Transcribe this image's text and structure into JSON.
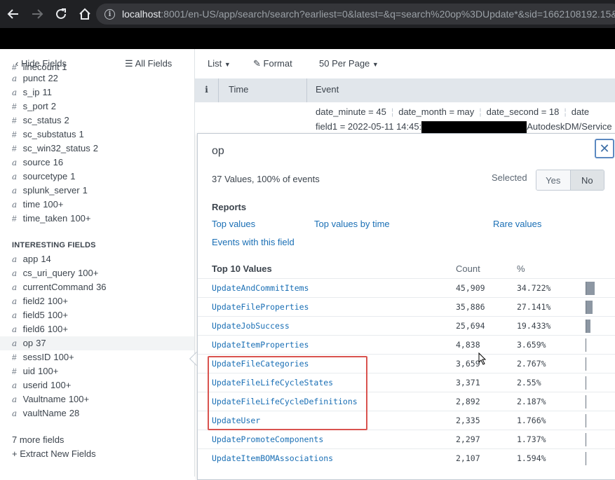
{
  "browser": {
    "url_host": "localhost",
    "url_rest": ":8001/en-US/app/search/search?earliest=0&latest=&q=search%20op%3DUpdate*&sid=1662108192.15&"
  },
  "sidebar": {
    "hide_fields": "Hide Fields",
    "all_fields": "All Fields",
    "top_partial": "linecount  1",
    "selected_fields": [
      {
        "type": "a",
        "name": "punct",
        "count": "22",
        "hash": true
      },
      {
        "type": "a",
        "name": "s_ip",
        "count": "11",
        "hash": false
      },
      {
        "type": "#",
        "name": "s_port",
        "count": "2",
        "hash": true
      },
      {
        "type": "#",
        "name": "sc_status",
        "count": "2",
        "hash": true
      },
      {
        "type": "#",
        "name": "sc_substatus",
        "count": "1",
        "hash": true
      },
      {
        "type": "#",
        "name": "sc_win32_status",
        "count": "2",
        "hash": true
      },
      {
        "type": "a",
        "name": "source",
        "count": "16",
        "hash": false
      },
      {
        "type": "a",
        "name": "sourcetype",
        "count": "1",
        "hash": false
      },
      {
        "type": "a",
        "name": "splunk_server",
        "count": "1",
        "hash": false
      },
      {
        "type": "a",
        "name": "time",
        "count": "100+",
        "hash": false
      },
      {
        "type": "#",
        "name": "time_taken",
        "count": "100+",
        "hash": true
      }
    ],
    "interesting_title": "INTERESTING FIELDS",
    "interesting_fields": [
      {
        "type": "a",
        "name": "app",
        "count": "14"
      },
      {
        "type": "a",
        "name": "cs_uri_query",
        "count": "100+"
      },
      {
        "type": "a",
        "name": "currentCommand",
        "count": "36"
      },
      {
        "type": "a",
        "name": "field2",
        "count": "100+"
      },
      {
        "type": "a",
        "name": "field5",
        "count": "100+"
      },
      {
        "type": "a",
        "name": "field6",
        "count": "100+"
      },
      {
        "type": "a",
        "name": "op",
        "count": "37"
      },
      {
        "type": "#",
        "name": "sessID",
        "count": "100+"
      },
      {
        "type": "#",
        "name": "uid",
        "count": "100+"
      },
      {
        "type": "a",
        "name": "userid",
        "count": "100+"
      },
      {
        "type": "a",
        "name": "Vaultname",
        "count": "100+"
      },
      {
        "type": "a",
        "name": "vaultName",
        "count": "28"
      }
    ],
    "more_fields": "7 more fields",
    "extract_fields": "+ Extract New Fields"
  },
  "toolbar": {
    "list": "List",
    "format": "Format",
    "per_page": "50 Per Page"
  },
  "table": {
    "col_i": "i",
    "col_time": "Time",
    "col_event": "Event"
  },
  "event": {
    "date_minute": "date_minute = 45",
    "date_month": "date_month = may",
    "date_second": "date_second = 18",
    "date_more": "date",
    "field1_label": "field1 =",
    "field1_value": "2022-05-11 14:45:",
    "field1_tail": "AutodeskDM/Service"
  },
  "popup": {
    "title": "op",
    "summary": "37 Values, 100% of events",
    "selected_label": "Selected",
    "yes": "Yes",
    "no": "No",
    "reports_title": "Reports",
    "top_values": "Top values",
    "top_values_by_time": "Top values by time",
    "rare_values": "Rare values",
    "events_with_field": "Events with this field",
    "top10_title": "Top 10 Values",
    "count_header": "Count",
    "pct_header": "%",
    "close_symbol": "✕",
    "values": [
      {
        "name": "UpdateAndCommitItems",
        "count": "45,909",
        "pct": "34.722%",
        "ratio": 34.722
      },
      {
        "name": "UpdateFileProperties",
        "count": "35,886",
        "pct": "27.141%",
        "ratio": 27.141
      },
      {
        "name": "UpdateJobSuccess",
        "count": "25,694",
        "pct": "19.433%",
        "ratio": 19.433
      },
      {
        "name": "UpdateItemProperties",
        "count": "4,838",
        "pct": "3.659%",
        "ratio": 3.659
      },
      {
        "name": "UpdateFileCategories",
        "count": "3,659",
        "pct": "2.767%",
        "ratio": 2.767
      },
      {
        "name": "UpdateFileLifeCycleStates",
        "count": "3,371",
        "pct": "2.55%",
        "ratio": 2.55
      },
      {
        "name": "UpdateFileLifeCycleDefinitions",
        "count": "2,892",
        "pct": "2.187%",
        "ratio": 2.187
      },
      {
        "name": "UpdateUser",
        "count": "2,335",
        "pct": "1.766%",
        "ratio": 1.766
      },
      {
        "name": "UpdatePromoteComponents",
        "count": "2,297",
        "pct": "1.737%",
        "ratio": 1.737
      },
      {
        "name": "UpdateItemBOMAssociations",
        "count": "2,107",
        "pct": "1.594%",
        "ratio": 1.594
      }
    ]
  },
  "colors": {
    "link": "#1a6fb5",
    "highlight": "#d9534f"
  }
}
